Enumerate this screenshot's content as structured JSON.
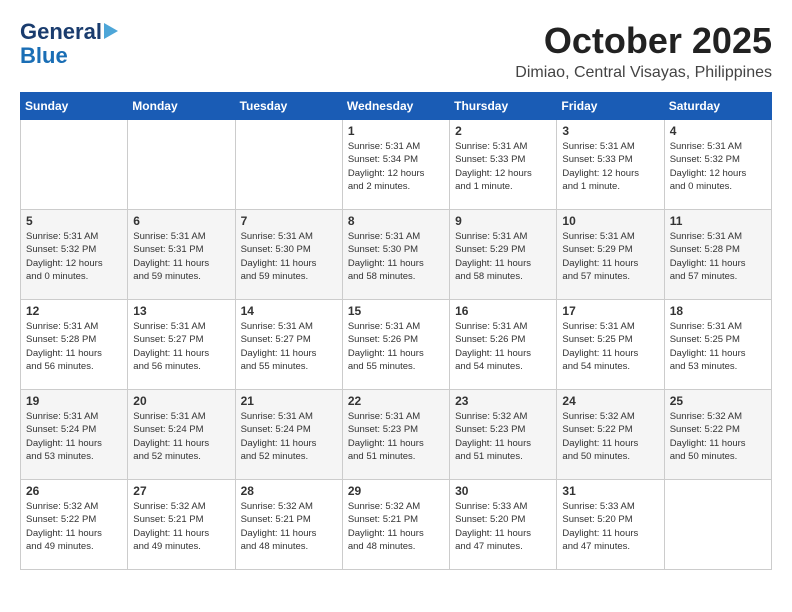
{
  "header": {
    "logo_line1": "General",
    "logo_line2": "Blue",
    "month_title": "October 2025",
    "location": "Dimiao, Central Visayas, Philippines"
  },
  "calendar": {
    "days_of_week": [
      "Sunday",
      "Monday",
      "Tuesday",
      "Wednesday",
      "Thursday",
      "Friday",
      "Saturday"
    ],
    "weeks": [
      [
        {
          "day": "",
          "info": ""
        },
        {
          "day": "",
          "info": ""
        },
        {
          "day": "",
          "info": ""
        },
        {
          "day": "1",
          "info": "Sunrise: 5:31 AM\nSunset: 5:34 PM\nDaylight: 12 hours\nand 2 minutes."
        },
        {
          "day": "2",
          "info": "Sunrise: 5:31 AM\nSunset: 5:33 PM\nDaylight: 12 hours\nand 1 minute."
        },
        {
          "day": "3",
          "info": "Sunrise: 5:31 AM\nSunset: 5:33 PM\nDaylight: 12 hours\nand 1 minute."
        },
        {
          "day": "4",
          "info": "Sunrise: 5:31 AM\nSunset: 5:32 PM\nDaylight: 12 hours\nand 0 minutes."
        }
      ],
      [
        {
          "day": "5",
          "info": "Sunrise: 5:31 AM\nSunset: 5:32 PM\nDaylight: 12 hours\nand 0 minutes."
        },
        {
          "day": "6",
          "info": "Sunrise: 5:31 AM\nSunset: 5:31 PM\nDaylight: 11 hours\nand 59 minutes."
        },
        {
          "day": "7",
          "info": "Sunrise: 5:31 AM\nSunset: 5:30 PM\nDaylight: 11 hours\nand 59 minutes."
        },
        {
          "day": "8",
          "info": "Sunrise: 5:31 AM\nSunset: 5:30 PM\nDaylight: 11 hours\nand 58 minutes."
        },
        {
          "day": "9",
          "info": "Sunrise: 5:31 AM\nSunset: 5:29 PM\nDaylight: 11 hours\nand 58 minutes."
        },
        {
          "day": "10",
          "info": "Sunrise: 5:31 AM\nSunset: 5:29 PM\nDaylight: 11 hours\nand 57 minutes."
        },
        {
          "day": "11",
          "info": "Sunrise: 5:31 AM\nSunset: 5:28 PM\nDaylight: 11 hours\nand 57 minutes."
        }
      ],
      [
        {
          "day": "12",
          "info": "Sunrise: 5:31 AM\nSunset: 5:28 PM\nDaylight: 11 hours\nand 56 minutes."
        },
        {
          "day": "13",
          "info": "Sunrise: 5:31 AM\nSunset: 5:27 PM\nDaylight: 11 hours\nand 56 minutes."
        },
        {
          "day": "14",
          "info": "Sunrise: 5:31 AM\nSunset: 5:27 PM\nDaylight: 11 hours\nand 55 minutes."
        },
        {
          "day": "15",
          "info": "Sunrise: 5:31 AM\nSunset: 5:26 PM\nDaylight: 11 hours\nand 55 minutes."
        },
        {
          "day": "16",
          "info": "Sunrise: 5:31 AM\nSunset: 5:26 PM\nDaylight: 11 hours\nand 54 minutes."
        },
        {
          "day": "17",
          "info": "Sunrise: 5:31 AM\nSunset: 5:25 PM\nDaylight: 11 hours\nand 54 minutes."
        },
        {
          "day": "18",
          "info": "Sunrise: 5:31 AM\nSunset: 5:25 PM\nDaylight: 11 hours\nand 53 minutes."
        }
      ],
      [
        {
          "day": "19",
          "info": "Sunrise: 5:31 AM\nSunset: 5:24 PM\nDaylight: 11 hours\nand 53 minutes."
        },
        {
          "day": "20",
          "info": "Sunrise: 5:31 AM\nSunset: 5:24 PM\nDaylight: 11 hours\nand 52 minutes."
        },
        {
          "day": "21",
          "info": "Sunrise: 5:31 AM\nSunset: 5:24 PM\nDaylight: 11 hours\nand 52 minutes."
        },
        {
          "day": "22",
          "info": "Sunrise: 5:31 AM\nSunset: 5:23 PM\nDaylight: 11 hours\nand 51 minutes."
        },
        {
          "day": "23",
          "info": "Sunrise: 5:32 AM\nSunset: 5:23 PM\nDaylight: 11 hours\nand 51 minutes."
        },
        {
          "day": "24",
          "info": "Sunrise: 5:32 AM\nSunset: 5:22 PM\nDaylight: 11 hours\nand 50 minutes."
        },
        {
          "day": "25",
          "info": "Sunrise: 5:32 AM\nSunset: 5:22 PM\nDaylight: 11 hours\nand 50 minutes."
        }
      ],
      [
        {
          "day": "26",
          "info": "Sunrise: 5:32 AM\nSunset: 5:22 PM\nDaylight: 11 hours\nand 49 minutes."
        },
        {
          "day": "27",
          "info": "Sunrise: 5:32 AM\nSunset: 5:21 PM\nDaylight: 11 hours\nand 49 minutes."
        },
        {
          "day": "28",
          "info": "Sunrise: 5:32 AM\nSunset: 5:21 PM\nDaylight: 11 hours\nand 48 minutes."
        },
        {
          "day": "29",
          "info": "Sunrise: 5:32 AM\nSunset: 5:21 PM\nDaylight: 11 hours\nand 48 minutes."
        },
        {
          "day": "30",
          "info": "Sunrise: 5:33 AM\nSunset: 5:20 PM\nDaylight: 11 hours\nand 47 minutes."
        },
        {
          "day": "31",
          "info": "Sunrise: 5:33 AM\nSunset: 5:20 PM\nDaylight: 11 hours\nand 47 minutes."
        },
        {
          "day": "",
          "info": ""
        }
      ]
    ]
  }
}
